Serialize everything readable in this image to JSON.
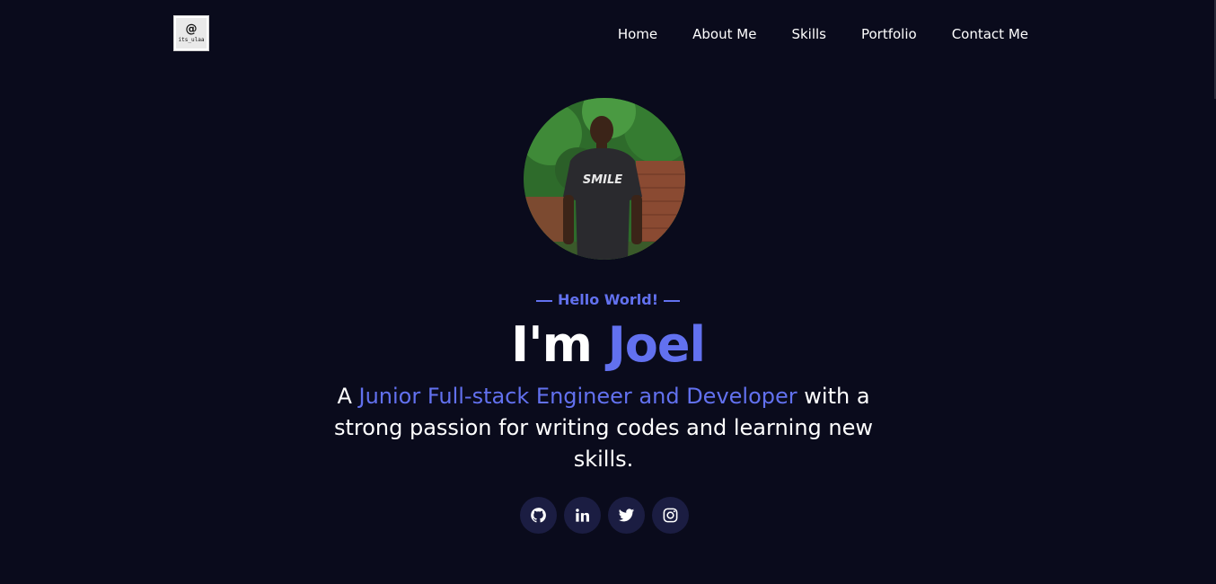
{
  "logo": {
    "symbol": "@",
    "text": "its_ulaa"
  },
  "nav": {
    "items": [
      {
        "label": "Home"
      },
      {
        "label": "About Me"
      },
      {
        "label": "Skills"
      },
      {
        "label": "Portfolio"
      },
      {
        "label": "Contact Me"
      }
    ]
  },
  "hero": {
    "greeting": "Hello World!",
    "headline_prefix": "I'm ",
    "headline_name": "Joel",
    "tagline_prefix": "A ",
    "tagline_role": "Junior Full-stack Engineer and Developer",
    "tagline_suffix": " with a strong passion for writing codes and learning new skills."
  },
  "socials": [
    {
      "icon": "github-icon"
    },
    {
      "icon": "linkedin-icon"
    },
    {
      "icon": "twitter-icon"
    },
    {
      "icon": "instagram-icon"
    }
  ],
  "colors": {
    "background": "#0a0b1c",
    "accent": "#6271ef",
    "social_bg": "#1b1d42",
    "text": "#ffffff"
  }
}
